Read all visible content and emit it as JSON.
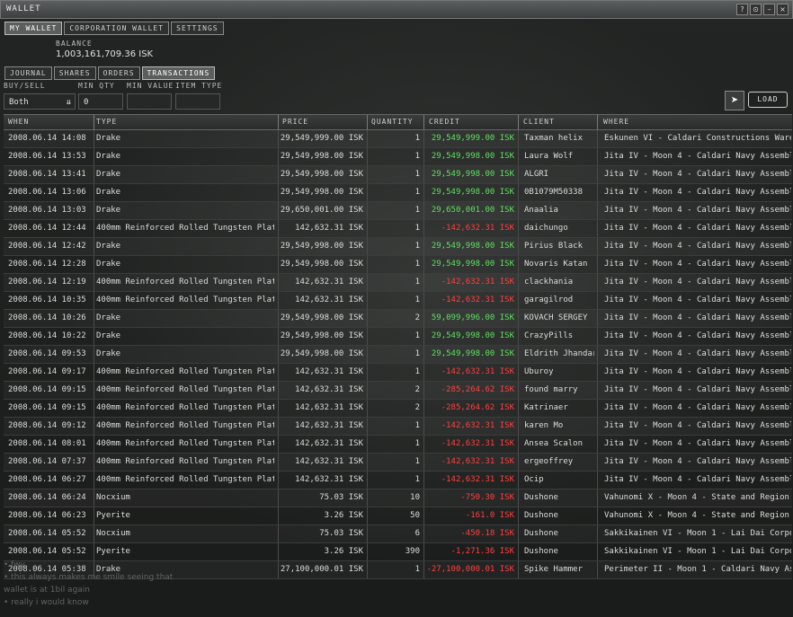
{
  "window": {
    "title": "WALLET",
    "buttons": [
      "?",
      "⊙",
      "–",
      "×"
    ]
  },
  "tabs_main": [
    {
      "label": "MY WALLET",
      "active": true
    },
    {
      "label": "CORPORATION WALLET",
      "active": false
    },
    {
      "label": "SETTINGS",
      "active": false
    }
  ],
  "balance": {
    "label": "BALANCE",
    "value": "1,003,161,709.36 ISK"
  },
  "tabs_sub": [
    {
      "label": "JOURNAL",
      "active": false
    },
    {
      "label": "SHARES",
      "active": false
    },
    {
      "label": "ORDERS",
      "active": false
    },
    {
      "label": "TRANSACTIONS",
      "active": true
    }
  ],
  "filters": {
    "buysell_label": "BUY/SELL",
    "buysell_value": "Both",
    "minqty_label": "MIN QTY",
    "minqty_value": "0",
    "minvalue_label": "MIN VALUE",
    "minvalue_value": "",
    "itemtype_label": "ITEM TYPE",
    "itemtype_value": "",
    "load_label": "LOAD",
    "icon": "market-arrow-icon"
  },
  "columns": [
    "WHEN",
    "TYPE",
    "PRICE",
    "QUANTITY",
    "CREDIT",
    "CLIENT",
    "WHERE"
  ],
  "rows": [
    {
      "when": "2008.06.14 14:08",
      "type": "Drake",
      "price": "29,549,999.00 ISK",
      "qty": "1",
      "credit": "29,549,999.00 ISK",
      "sign": "pos",
      "client": "Taxman helix",
      "where": "Eskunen VI - Caldari Constructions Warehous"
    },
    {
      "when": "2008.06.14 13:53",
      "type": "Drake",
      "price": "29,549,998.00 ISK",
      "qty": "1",
      "credit": "29,549,998.00 ISK",
      "sign": "pos",
      "client": "Laura Wolf",
      "where": "Jita IV - Moon 4 - Caldari Navy Assembly Pl"
    },
    {
      "when": "2008.06.14 13:41",
      "type": "Drake",
      "price": "29,549,998.00 ISK",
      "qty": "1",
      "credit": "29,549,998.00 ISK",
      "sign": "pos",
      "client": "ALGRI",
      "where": "Jita IV - Moon 4 - Caldari Navy Assembly Pl"
    },
    {
      "when": "2008.06.14 13:06",
      "type": "Drake",
      "price": "29,549,998.00 ISK",
      "qty": "1",
      "credit": "29,549,998.00 ISK",
      "sign": "pos",
      "client": "0B1079M50338",
      "where": "Jita IV - Moon 4 - Caldari Navy Assembly Pl"
    },
    {
      "when": "2008.06.14 13:03",
      "type": "Drake",
      "price": "29,650,001.00 ISK",
      "qty": "1",
      "credit": "29,650,001.00 ISK",
      "sign": "pos",
      "client": "Anaalia",
      "where": "Jita IV - Moon 4 - Caldari Navy Assembly Pl"
    },
    {
      "when": "2008.06.14 12:44",
      "type": "400mm Reinforced Rolled Tungsten Plates I",
      "price": "142,632.31 ISK",
      "qty": "1",
      "credit": "-142,632.31 ISK",
      "sign": "neg",
      "client": "daichungo",
      "where": "Jita IV - Moon 4 - Caldari Navy Assembly Pl"
    },
    {
      "when": "2008.06.14 12:42",
      "type": "Drake",
      "price": "29,549,998.00 ISK",
      "qty": "1",
      "credit": "29,549,998.00 ISK",
      "sign": "pos",
      "client": "Pirius Black",
      "where": "Jita IV - Moon 4 - Caldari Navy Assembly Pl"
    },
    {
      "when": "2008.06.14 12:28",
      "type": "Drake",
      "price": "29,549,998.00 ISK",
      "qty": "1",
      "credit": "29,549,998.00 ISK",
      "sign": "pos",
      "client": "Novaris Katan",
      "where": "Jita IV - Moon 4 - Caldari Navy Assembly Pl"
    },
    {
      "when": "2008.06.14 12:19",
      "type": "400mm Reinforced Rolled Tungsten Plates I",
      "price": "142,632.31 ISK",
      "qty": "1",
      "credit": "-142,632.31 ISK",
      "sign": "neg",
      "client": "clackhania",
      "where": "Jita IV - Moon 4 - Caldari Navy Assembly Pl"
    },
    {
      "when": "2008.06.14 10:35",
      "type": "400mm Reinforced Rolled Tungsten Plates I",
      "price": "142,632.31 ISK",
      "qty": "1",
      "credit": "-142,632.31 ISK",
      "sign": "neg",
      "client": "garagilrod",
      "where": "Jita IV - Moon 4 - Caldari Navy Assembly Pl"
    },
    {
      "when": "2008.06.14 10:26",
      "type": "Drake",
      "price": "29,549,998.00 ISK",
      "qty": "2",
      "credit": "59,099,996.00 ISK",
      "sign": "pos",
      "client": "KOVACH SERGEY",
      "where": "Jita IV - Moon 4 - Caldari Navy Assembly Pl"
    },
    {
      "when": "2008.06.14 10:22",
      "type": "Drake",
      "price": "29,549,998.00 ISK",
      "qty": "1",
      "credit": "29,549,998.00 ISK",
      "sign": "pos",
      "client": "CrazyPills",
      "where": "Jita IV - Moon 4 - Caldari Navy Assembly Pl"
    },
    {
      "when": "2008.06.14 09:53",
      "type": "Drake",
      "price": "29,549,998.00 ISK",
      "qty": "1",
      "credit": "29,549,998.00 ISK",
      "sign": "pos",
      "client": "Eldrith Jhandar",
      "where": "Jita IV - Moon 4 - Caldari Navy Assembly Pl"
    },
    {
      "when": "2008.06.14 09:17",
      "type": "400mm Reinforced Rolled Tungsten Plates I",
      "price": "142,632.31 ISK",
      "qty": "1",
      "credit": "-142,632.31 ISK",
      "sign": "neg",
      "client": "Uburoy",
      "where": "Jita IV - Moon 4 - Caldari Navy Assembly Pl"
    },
    {
      "when": "2008.06.14 09:15",
      "type": "400mm Reinforced Rolled Tungsten Plates I",
      "price": "142,632.31 ISK",
      "qty": "2",
      "credit": "-285,264.62 ISK",
      "sign": "neg",
      "client": "found marry",
      "where": "Jita IV - Moon 4 - Caldari Navy Assembly Pl"
    },
    {
      "when": "2008.06.14 09:15",
      "type": "400mm Reinforced Rolled Tungsten Plates I",
      "price": "142,632.31 ISK",
      "qty": "2",
      "credit": "-285,264.62 ISK",
      "sign": "neg",
      "client": "Katrinaer",
      "where": "Jita IV - Moon 4 - Caldari Navy Assembly Pl"
    },
    {
      "when": "2008.06.14 09:12",
      "type": "400mm Reinforced Rolled Tungsten Plates I",
      "price": "142,632.31 ISK",
      "qty": "1",
      "credit": "-142,632.31 ISK",
      "sign": "neg",
      "client": "karen Mo",
      "where": "Jita IV - Moon 4 - Caldari Navy Assembly Pl"
    },
    {
      "when": "2008.06.14 08:01",
      "type": "400mm Reinforced Rolled Tungsten Plates I",
      "price": "142,632.31 ISK",
      "qty": "1",
      "credit": "-142,632.31 ISK",
      "sign": "neg",
      "client": "Ansea Scalon",
      "where": "Jita IV - Moon 4 - Caldari Navy Assembly Pl"
    },
    {
      "when": "2008.06.14 07:37",
      "type": "400mm Reinforced Rolled Tungsten Plates I",
      "price": "142,632.31 ISK",
      "qty": "1",
      "credit": "-142,632.31 ISK",
      "sign": "neg",
      "client": "ergeoffrey",
      "where": "Jita IV - Moon 4 - Caldari Navy Assembly Pl"
    },
    {
      "when": "2008.06.14 06:27",
      "type": "400mm Reinforced Rolled Tungsten Plates I",
      "price": "142,632.31 ISK",
      "qty": "1",
      "credit": "-142,632.31 ISK",
      "sign": "neg",
      "client": "Ocip",
      "where": "Jita IV - Moon 4 - Caldari Navy Assembly Pl"
    },
    {
      "when": "2008.06.14 06:24",
      "type": "Nocxium",
      "price": "75.03 ISK",
      "qty": "10",
      "credit": "-750.30 ISK",
      "sign": "neg",
      "client": "Dushone",
      "where": "Vahunomi X - Moon 4 - State and Region Ba"
    },
    {
      "when": "2008.06.14 06:23",
      "type": "Pyerite",
      "price": "3.26 ISK",
      "qty": "50",
      "credit": "-161.0 ISK",
      "sign": "neg",
      "client": "Dushone",
      "where": "Vahunomi X - Moon 4 - State and Region Ba"
    },
    {
      "when": "2008.06.14 05:52",
      "type": "Nocxium",
      "price": "75.03 ISK",
      "qty": "6",
      "credit": "-450.18 ISK",
      "sign": "neg",
      "client": "Dushone",
      "where": "Sakkikainen VI - Moon 1 - Lai Dai Corporatic"
    },
    {
      "when": "2008.06.14 05:52",
      "type": "Pyerite",
      "price": "3.26 ISK",
      "qty": "390",
      "credit": "-1,271.36 ISK",
      "sign": "neg",
      "client": "Dushone",
      "where": "Sakkikainen VI - Moon 1 - Lai Dai Corporatic"
    },
    {
      "when": "2008.06.14 05:38",
      "type": "Drake",
      "price": "27,100,000.01 ISK",
      "qty": "1",
      "credit": "-27,100,000.01 ISK",
      "sign": "neg",
      "client": "Spike Hammer",
      "where": "Perimeter II - Moon 1 - Caldari Navy Assemb"
    }
  ],
  "chat_lines": [
    "• fwy",
    "• this always makes me smile seeing that",
    "wallet is at 1bil again",
    "• really i would know"
  ]
}
